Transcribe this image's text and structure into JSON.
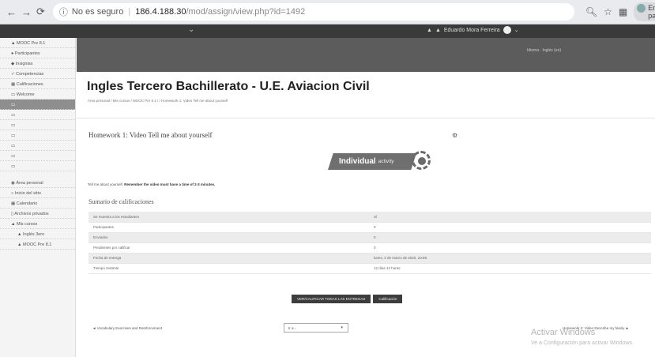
{
  "browser": {
    "not_secure": "No es seguro",
    "host": "186.4.188.30",
    "path": "/mod/assign/view.php?id=1492",
    "pause_label": "En pausa"
  },
  "topnav": {
    "user_name": "Eduardo Mora Ferreira"
  },
  "header_links": "Idioma - Inglés (en)",
  "sidebar": {
    "top": [
      "MOOC Pre 8.1",
      "Participantes",
      "Insignias",
      "Competencias",
      "Calificaciones",
      "Welcome",
      "",
      "",
      "",
      "",
      "",
      "",
      ""
    ],
    "bottom": [
      "Área personal",
      "Inicio del sitio",
      "Calendario",
      "Archivos privados",
      "Mis cursos",
      "Inglés 3ero",
      "MOOC Pre 8.1"
    ]
  },
  "course_title": "Ingles Tercero Bachillerato - U.E. Aviacion Civil",
  "breadcrumb": "Área personal / Mis cursos / MOOC Pre 8.1 / / Homework 1: Video Tell me about yourself",
  "assignment": {
    "title": "Homework 1: Video Tell me about yourself",
    "activity_bold": "Individual",
    "activity_light": "activity",
    "instruction_plain": "Tell me about yourself.",
    "instruction_bold": "Remember the video must have a time of 2-3 minutes."
  },
  "summary_title": "Sumario de calificaciones",
  "grading_rows": [
    {
      "label": "Se muestra a los estudiantes",
      "value": "Sí"
    },
    {
      "label": "Participantes",
      "value": "0"
    },
    {
      "label": "Enviados",
      "value": "0"
    },
    {
      "label": "Pendientes por calificar",
      "value": "0"
    },
    {
      "label": "Fecha de entrega",
      "value": "lunes, 2 de marzo de 2020, 23:59"
    },
    {
      "label": "Tiempo restante",
      "value": "12 días 12 horas"
    }
  ],
  "buttons": {
    "view_all": "VER/CALIFICAR TODAS LAS ENTREGAS",
    "grade": "Calificación"
  },
  "bottom_nav": {
    "prev": "◄ Vocabulary Exercises and Reinforcement",
    "jump": "Ir a...",
    "next": "Homework 2: Video Describe my family ►"
  },
  "watermark": {
    "line1": "Activar Windows",
    "line2": "Ve a Configuración para activar Windows."
  }
}
